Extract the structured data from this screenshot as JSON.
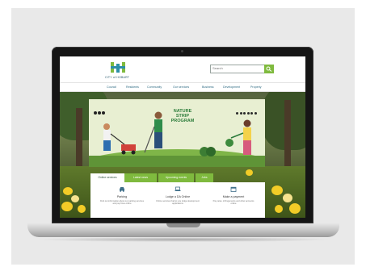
{
  "site": {
    "logo_text": "CITY of HOBART",
    "colors": {
      "accent": "#7fba3e",
      "brand": "#1d4f64",
      "nav_text": "#2f6b83"
    }
  },
  "search": {
    "placeholder": "Search",
    "icon": "search-icon"
  },
  "nav": {
    "items": [
      "Council",
      "Residents",
      "Community",
      "Our services",
      "Business",
      "Development",
      "Property"
    ]
  },
  "hero": {
    "banner_title": "NATURE STRIP PROGRAM",
    "social_icons": [
      "facebook-icon",
      "twitter-icon",
      "instagram-icon"
    ]
  },
  "tabs": [
    {
      "label": "Online services",
      "active": true
    },
    {
      "label": "Latest news",
      "active": false
    },
    {
      "label": "Upcoming events",
      "active": false
    },
    {
      "label": "Jobs",
      "active": false
    }
  ],
  "cards": [
    {
      "icon": "car-icon",
      "title": "Parking",
      "desc": "Find out information about our parking services and pay fines online"
    },
    {
      "icon": "laptop-icon",
      "title": "Lodge a DA Online",
      "desc": "Online services that let you lodge development applications"
    },
    {
      "icon": "calendar-icon",
      "title": "Make a payment",
      "desc": "Pay rates, infringements and other accounts online"
    }
  ]
}
